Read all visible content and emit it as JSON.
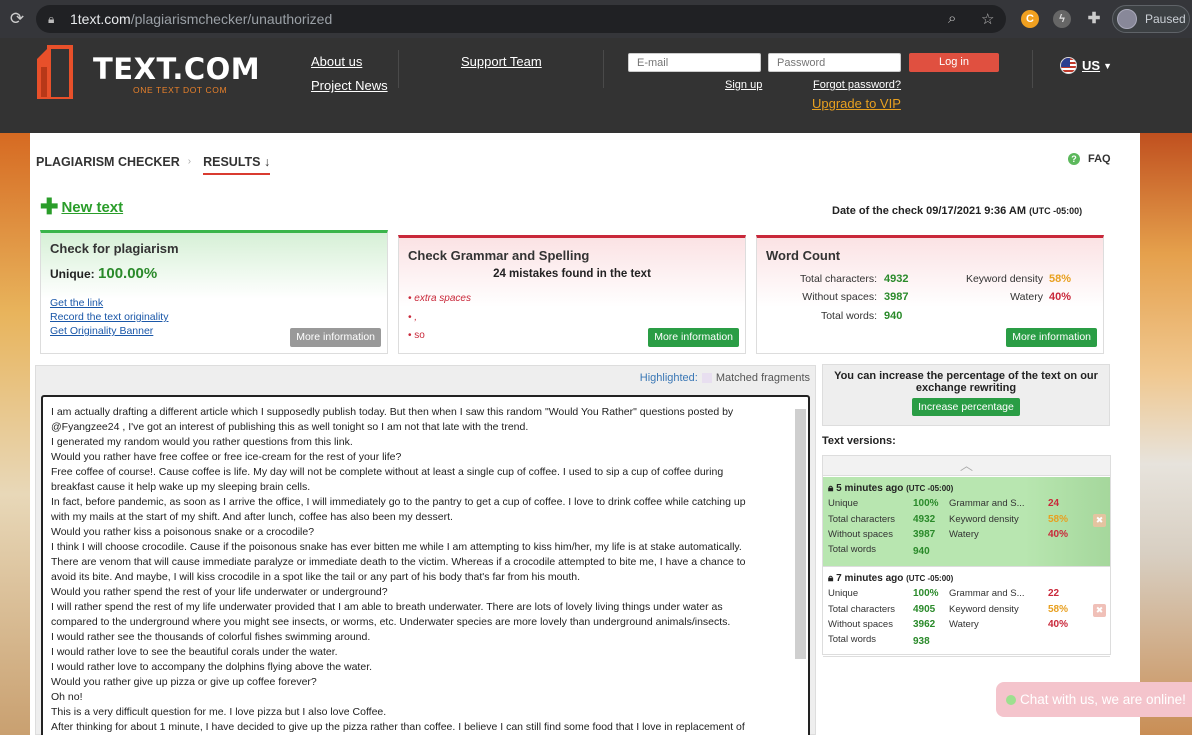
{
  "browser": {
    "url_host": "1text.com",
    "url_path": "/plagiarismchecker/unauthorized",
    "profile_status": "Paused"
  },
  "header": {
    "logo_text": "TEXT.COM",
    "logo_sub": "ONE TEXT DOT COM",
    "nav": {
      "about": "About us",
      "news": "Project News",
      "support": "Support Team"
    },
    "email_placeholder": "E-mail",
    "password_placeholder": "Password",
    "login_label": "Log in",
    "signup_label": "Sign up",
    "forgot_label": "Forgot password?",
    "vip_label": "Upgrade to VIP",
    "lang_label": "US"
  },
  "page": {
    "breadcrumb_1": "PLAGIARISM CHECKER",
    "breadcrumb_2": "RESULTS ↓",
    "faq_label": "FAQ",
    "new_text_label": "New text",
    "date_label": "Date of the check 09/17/2021 9:36 AM",
    "date_tz": "(UTC -05:00)"
  },
  "plagiarism_card": {
    "title": "Check for plagiarism",
    "unique_label": "Unique:",
    "unique_value": "100.00%",
    "links": [
      "Get the link",
      "Record the text originality",
      "Get Originality Banner"
    ],
    "more_label": "More information"
  },
  "grammar_card": {
    "title": "Check Grammar and Spelling",
    "summary": "24 mistakes found in the text",
    "items": [
      "extra spaces",
      ",",
      "so"
    ],
    "more_label": "More information"
  },
  "word_card": {
    "title": "Word Count",
    "rows": [
      {
        "label": "Total characters:",
        "value": "4932"
      },
      {
        "label": "Without spaces:",
        "value": "3987"
      },
      {
        "label": "Total words:",
        "value": "940"
      }
    ],
    "density_label": "Keyword density",
    "density_value": "58%",
    "watery_label": "Watery",
    "watery_value": "40%",
    "more_label": "More information"
  },
  "text_panel": {
    "highlighted_label": "Highlighted:",
    "matched_label": "Matched fragments",
    "lines": [
      "I am actually drafting a different article which I supposedly publish today. But then when I saw this random \"Would You Rather\" questions posted by",
      "@Fyangzee24 , I've got an interest of publishing this as well tonight so I am not that late with the trend.",
      "I generated my random would you rather questions from this link.",
      "Would you rather have free coffee or free ice-cream for the rest of your life?",
      "Free coffee of course!. Cause coffee is life. My day will not be complete without at least a single cup of coffee. I used to sip a cup of coffee during",
      "breakfast cause it help wake up my sleeping brain cells.",
      "In fact, before pandemic, as soon as I arrive the office, I will immediately go to the pantry to get a cup of coffee. I love to drink coffee while catching up",
      "with my mails at the start of my shift. And after lunch, coffee has also been my dessert.",
      "Would you rather kiss a poisonous snake or a crocodile?",
      "I think I will choose crocodile. Cause if the poisonous snake has ever bitten me while I am attempting to kiss him/her, my life is at stake automatically.",
      "There are venom that will cause immediate paralyze or immediate death to the victim.  Whereas if a crocodile attempted to bite me, I have a chance to",
      "avoid its bite. And maybe, I will kiss crocodile in a spot like the tail or any part of his body that's far from his mouth.",
      "Would you rather spend the rest of your life underwater or underground?",
      "I will rather spend the rest of my life underwater provided that I am able to breath underwater.  There are lots of lovely living things under water as",
      "compared to the underground where you might see insects, or worms, etc. Underwater species are more lovely than underground animals/insects.",
      "I would rather see the thousands of colorful  fishes swimming around.",
      "I would rather love to see the beautiful corals under the water.",
      "I would rather love to accompany the dolphins flying above the water.",
      "Would you rather give up pizza or give up coffee forever?",
      "Oh no!",
      "This is a very difficult question for me. I love pizza but I also love Coffee.",
      "After thinking for about 1 minute, I have decided to give up the pizza rather than coffee. I believe I can still find some food that I love in replacement of"
    ]
  },
  "sidebar": {
    "increase_text": "You can increase the percentage of the text on our exchange rewriting",
    "increase_btn": "Increase percentage",
    "versions_label": "Text versions:",
    "versions": [
      {
        "time": "5 minutes ago",
        "tz": "(UTC -05:00)",
        "unique": "100%",
        "grammar": "24",
        "chars": "4932",
        "density": "58%",
        "nospaces": "3987",
        "watery": "40%",
        "words": "940"
      },
      {
        "time": "7 minutes ago",
        "tz": "(UTC -05:00)",
        "unique": "100%",
        "grammar": "22",
        "chars": "4905",
        "density": "58%",
        "nospaces": "3962",
        "watery": "40%",
        "words": "938"
      }
    ],
    "labels": {
      "unique": "Unique",
      "grammar": "Grammar and S...",
      "chars": "Total characters",
      "density": "Keyword density",
      "nospaces": "Without spaces",
      "watery": "Watery",
      "words": "Total words"
    }
  },
  "chat": {
    "label": "Chat with us, we are online!"
  }
}
